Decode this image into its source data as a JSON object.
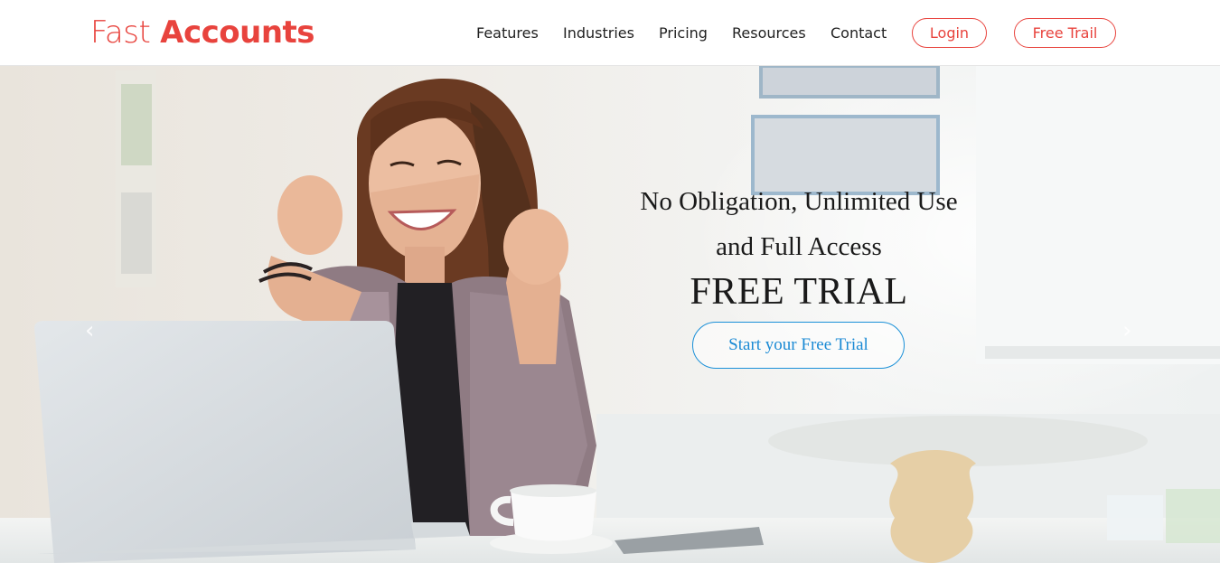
{
  "brand": {
    "name_light": "Fast",
    "name_bold": "Accounts",
    "color": "#e8433d"
  },
  "nav": {
    "features": "Features",
    "industries": "Industries",
    "pricing": "Pricing",
    "resources": "Resources",
    "contact": "Contact",
    "login": "Login",
    "free_trial": "Free Trail"
  },
  "hero": {
    "line1": "No Obligation, Unlimited Use",
    "line2": "and Full Access",
    "headline": "FREE TRIAL",
    "cta_label": "Start your Free Trial",
    "cta_color": "#1a8ad4",
    "prev_icon": "chevron-left-icon",
    "next_icon": "chevron-right-icon"
  }
}
